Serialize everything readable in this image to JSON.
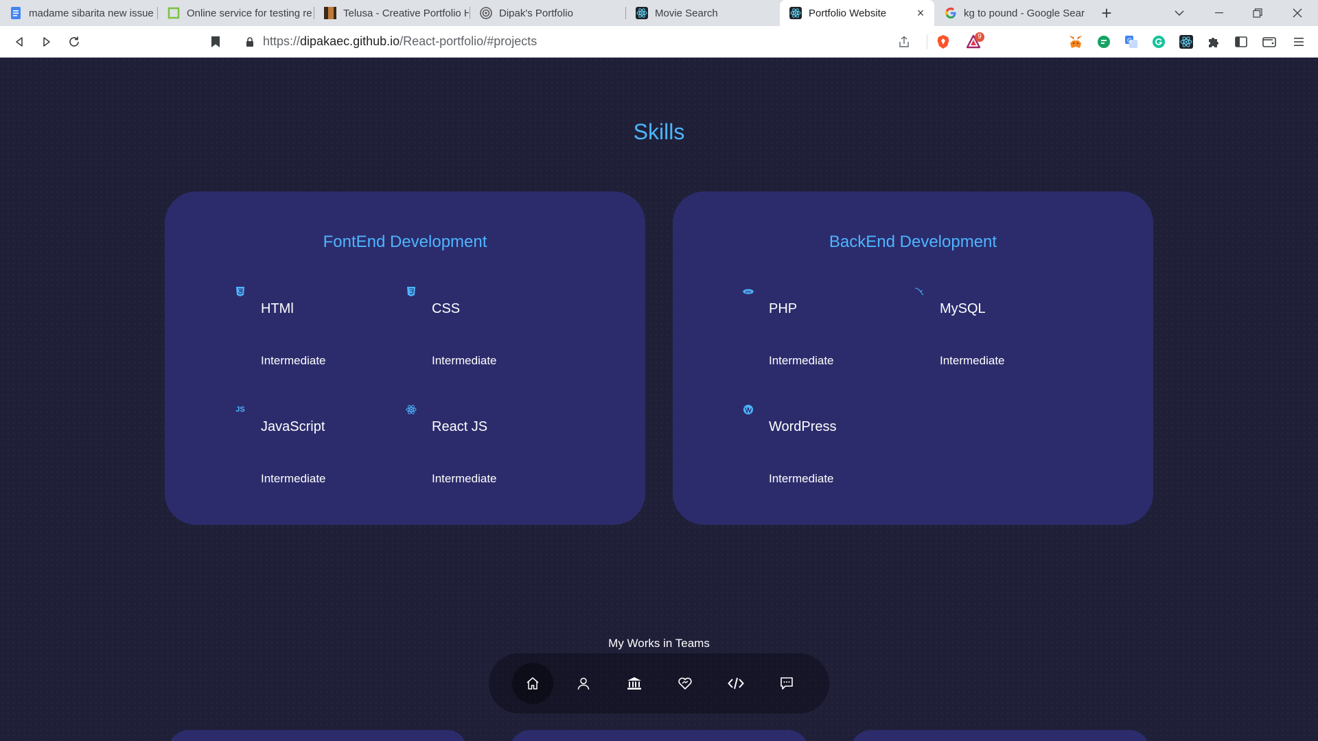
{
  "browser": {
    "tabs": [
      {
        "title": "madame sibarita new issue",
        "icon": "docs-icon"
      },
      {
        "title": "Online service for testing re",
        "icon": "square-icon"
      },
      {
        "title": "Telusa - Creative Portfolio H",
        "icon": "image-icon"
      },
      {
        "title": "Dipak's Portfolio",
        "icon": "broadcast-icon"
      },
      {
        "title": "Movie Search",
        "icon": "react-icon"
      },
      {
        "title": "Portfolio Website",
        "icon": "react-icon"
      },
      {
        "title": "kg to pound - Google Sear",
        "icon": "google-icon"
      }
    ],
    "active_tab": 5,
    "url_scheme": "https://",
    "url_host": "dipakaec.github.io",
    "url_path": "/React-portfolio/#projects",
    "notification_count": "9"
  },
  "page": {
    "section_title": "Skills",
    "cards": [
      {
        "title": "FontEnd Development",
        "skills": [
          {
            "name": "HTMl",
            "level": "Intermediate",
            "icon": "html5-icon"
          },
          {
            "name": "CSS",
            "level": "Intermediate",
            "icon": "css3-icon"
          },
          {
            "name": "JavaScript",
            "level": "Intermediate",
            "icon": "js-icon"
          },
          {
            "name": "React JS",
            "level": "Intermediate",
            "icon": "react-icon"
          }
        ]
      },
      {
        "title": "BackEnd Development",
        "skills": [
          {
            "name": "PHP",
            "level": "Intermediate",
            "icon": "php-icon"
          },
          {
            "name": "MySQL",
            "level": "Intermediate",
            "icon": "mysql-icon"
          },
          {
            "name": "WordPress",
            "level": "Intermediate",
            "icon": "wordpress-icon"
          }
        ]
      }
    ],
    "icon_labels": {
      "js": "JS",
      "php": "php"
    },
    "teams_label": "My Works in Teams",
    "nav": [
      "home-icon",
      "user-icon",
      "bank-icon",
      "handshake-icon",
      "code-icon",
      "message-icon"
    ],
    "colors": {
      "accent": "#4db5ff",
      "card": "#2c2c6c",
      "background": "#1f1f38"
    }
  }
}
